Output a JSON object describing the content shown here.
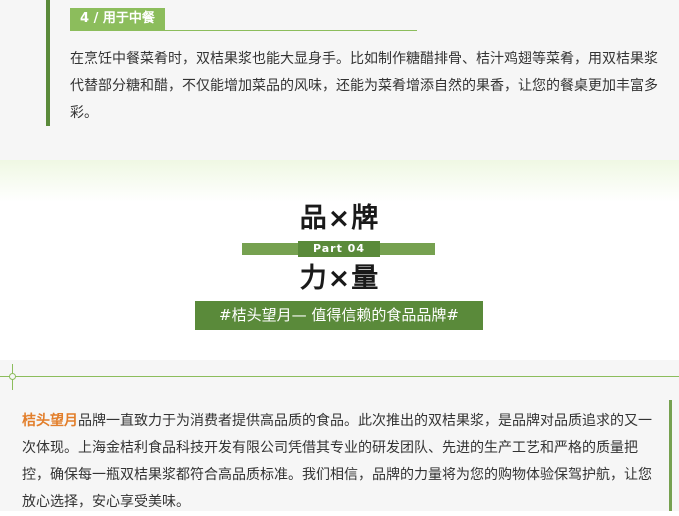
{
  "tip": {
    "tag": "4 / 用于中餐",
    "text": "在烹饪中餐菜肴时，双桔果浆也能大显身手。比如制作糖醋排骨、桔汁鸡翅等菜肴，用双桔果浆代替部分糖和醋，不仅能增加菜品的风味，还能为菜肴增添自然的果香，让您的餐桌更加丰富多彩。"
  },
  "brand_header": {
    "title_top": "品×牌",
    "part_label": "Part 04",
    "title_bottom": "力×量",
    "slogan": "#桔头望月— 值得信赖的食品品牌#"
  },
  "brand_paragraph": {
    "brand_name": "桔头望月",
    "text": "品牌一直致力于为消费者提供高品质的食品。此次推出的双桔果浆，是品牌对品质追求的又一次体现。上海金桔利食品科技开发有限公司凭借其专业的研发团队、先进的生产工艺和严格的质量把控，确保每一瓶双桔果浆都符合高品质标准。我们相信，品牌的力量将为您的购物体验保驾护航，让您放心选择，安心享受美味。"
  },
  "colors": {
    "accent_green": "#5a8a3a",
    "light_green": "#8cbd5c",
    "brand_orange": "#e27e2a"
  }
}
